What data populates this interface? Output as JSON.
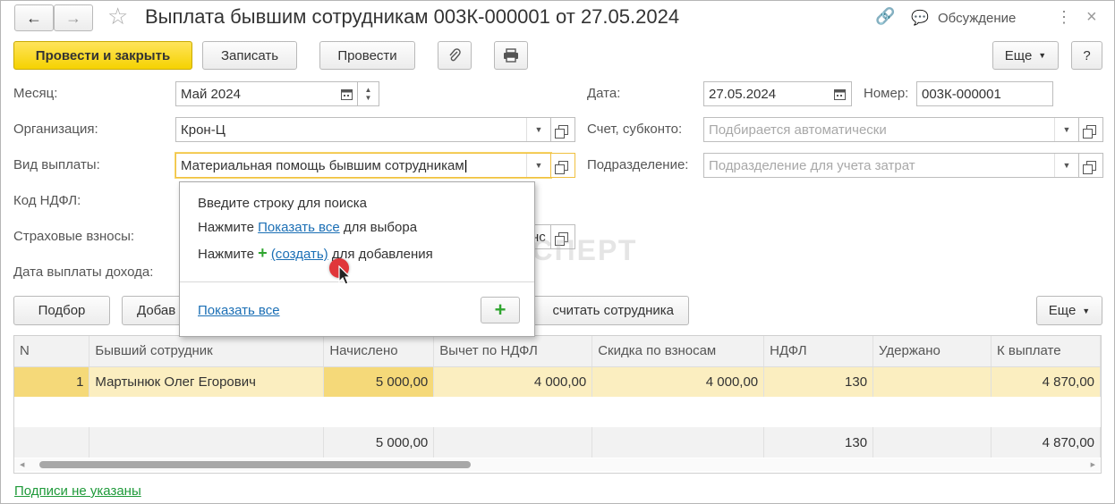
{
  "title": "Выплата бывшим сотрудникам 003К-000001 от 27.05.2024",
  "header": {
    "discussion_label": "Обсуждение"
  },
  "toolbar": {
    "post_close": "Провести и закрыть",
    "save": "Записать",
    "post": "Провести",
    "more": "Еще",
    "help": "?"
  },
  "form": {
    "month_label": "Месяц:",
    "month_value": "Май 2024",
    "org_label": "Организация:",
    "org_value": "Крон-Ц",
    "paytype_label": "Вид выплаты:",
    "paytype_value": "Материальная помощь бывшим сотрудникам",
    "ndfl_label": "Код НДФЛ:",
    "insurance_label": "Страховые взносы:",
    "paydate_label": "Дата выплаты дохода:",
    "date_label": "Дата:",
    "date_value": "27.05.2024",
    "number_label": "Номер:",
    "number_value": "003К-000001",
    "account_label": "Счет, субконто:",
    "account_placeholder": "Подбирается автоматически",
    "dept_label": "Подразделение:",
    "dept_placeholder": "Подразделение для учета затрат"
  },
  "popup": {
    "line1": "Введите строку для поиска",
    "line2_prefix": "Нажмите ",
    "line2_link": "Показать все",
    "line2_suffix": " для выбора",
    "line3_prefix": "Нажмите ",
    "line3_link": "(создать)",
    "line3_suffix": " для добавления",
    "show_all": "Показать все"
  },
  "table_toolbar": {
    "pick": "Подбор",
    "add_partial": "Добав",
    "recalc_partial": "считать сотрудника",
    "more": "Еще"
  },
  "watermark": "БУХЭКСПЕРТ",
  "table": {
    "headers": [
      "N",
      "Бывший сотрудник",
      "Начислено",
      "Вычет по НДФЛ",
      "Скидка по взносам",
      "НДФЛ",
      "Удержано",
      "К выплате"
    ],
    "rows": [
      [
        "1",
        "Мартынюк Олег Егорович",
        "5 000,00",
        "4 000,00",
        "4 000,00",
        "130",
        "",
        "4 870,00"
      ]
    ],
    "totals": [
      "",
      "",
      "5 000,00",
      "",
      "",
      "130",
      "",
      "4 870,00"
    ]
  },
  "footer": {
    "signatures": "Подписи не указаны"
  },
  "colors": {
    "primary_button": "#f5d200",
    "selected_row": "#fbeec0",
    "link": "#1b6fb5",
    "footer_link": "#1f9a3a",
    "accent_green": "#2fa52f"
  }
}
